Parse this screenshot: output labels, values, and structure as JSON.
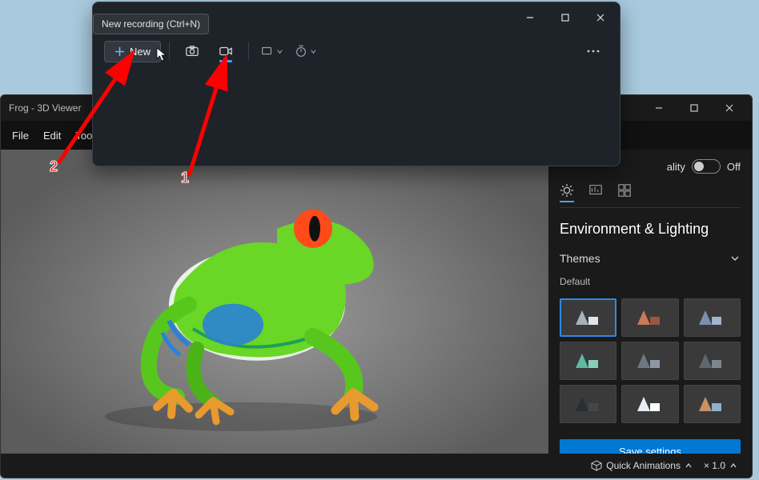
{
  "recorder": {
    "tooltip": "New recording (Ctrl+N)",
    "new_label": "New",
    "window_controls": {
      "min": "—",
      "max": "▢",
      "close": "✕"
    }
  },
  "viewer": {
    "title": "Frog - 3D Viewer",
    "menu": {
      "file": "File",
      "edit": "Edit",
      "tools": "Tools"
    },
    "quality_label": "ality",
    "quality_state": "Off",
    "panel_heading": "Environment & Lighting",
    "themes_header": "Themes",
    "themes_sub": "Default",
    "save_btn": "Save settings",
    "status": {
      "quick_anim": "Quick Animations",
      "zoom": "× 1.0"
    }
  },
  "annotations": {
    "one": "1",
    "two": "2"
  }
}
